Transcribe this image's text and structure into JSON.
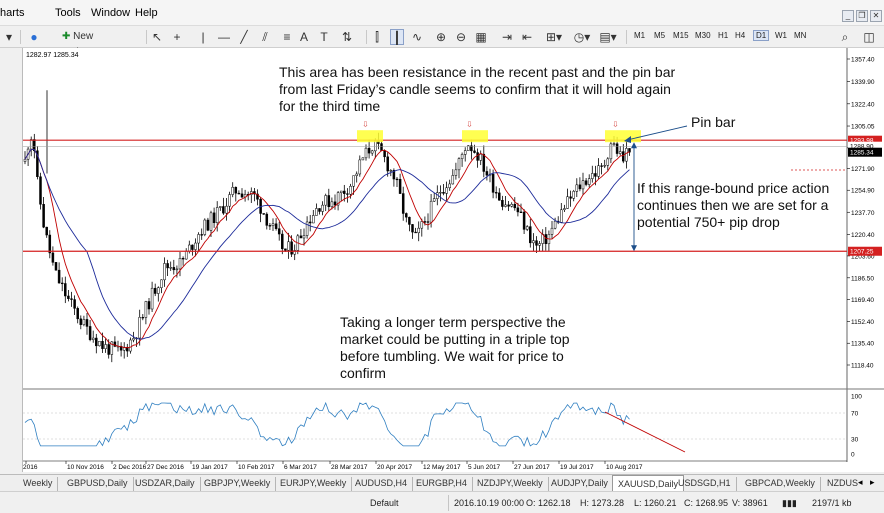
{
  "menu": {
    "items": [
      "harts",
      "Tools",
      "Window",
      "Help"
    ]
  },
  "toolbar": {
    "new_order_label": "New Order",
    "timeframes": [
      "M1",
      "M5",
      "M15",
      "M30",
      "H1",
      "H4",
      "D1",
      "W1",
      "MN"
    ],
    "active_timeframe": "D1"
  },
  "chart": {
    "ohlc_header": "1282.97 1285.34",
    "price_axis": [
      "1357.40",
      "1339.90",
      "1322.40",
      "1305.05",
      "1288.00",
      "1271.90",
      "1254.90",
      "1237.70",
      "1220.40",
      "1203.60",
      "1186.50",
      "1169.40",
      "1152.40",
      "1135.40",
      "1118.40"
    ],
    "price_label_upper": "1293.98",
    "price_label_mid": "1288.90",
    "price_label_current": "1285.34",
    "price_label_lower": "1207.25",
    "date_axis": [
      "2016",
      "10 Nov 2016",
      "2 Dec 2016",
      "27 Dec 2016",
      "19 Jan 2017",
      "10 Feb 2017",
      "6 Mar 2017",
      "28 Mar 2017",
      "20 Apr 2017",
      "12 May 2017",
      "5 Jun 2017",
      "27 Jun 2017",
      "19 Jul 2017",
      "10 Aug 2017"
    ],
    "indicator_axis": [
      "100",
      "70",
      "30",
      "0"
    ],
    "resistance_price": 1293.98,
    "support_price": 1207.25
  },
  "annotations": {
    "resistance_note": "This area has been resistance in the recent past and the pin bar from last Friday’s candle seems to confirm that it will hold again for the third time",
    "pin_bar_label": "Pin bar",
    "range_note": "If this range-bound price action continues then we are set for a potential 750+ pip drop",
    "triple_top_note": "Taking a longer term perspective the market could be putting in a triple top before tumbling. We wait for price to confirm"
  },
  "tabs": {
    "items": [
      "Weekly",
      "GBPUSD,Daily",
      "USDZAR,Daily",
      "GBPJPY,Weekly",
      "EURJPY,Weekly",
      "AUDUSD,H4",
      "EURGBP,H4",
      "NZDJPY,Weekly",
      "AUDJPY,Daily",
      "XAUUSD,Daily",
      "USDSGD,H1",
      "GBPCAD,Weekly",
      "NZDUS"
    ],
    "active": "XAUUSD,Daily"
  },
  "status": {
    "profile": "Default",
    "datetime": "2016.10.19 00:00",
    "open": "O: 1262.18",
    "high": "H: 1273.28",
    "low": "L: 1260.21",
    "close": "C: 1268.95",
    "volume": "V: 38961",
    "traffic": "2197/1 kb"
  },
  "colors": {
    "level_line": "#d42020",
    "candle": "#000000",
    "ma_fast": "#c00000",
    "ma_slow": "#1d2b9a",
    "indicator": "#2f7fc1",
    "highlight": "#ffff33",
    "arrow": "#1c4e8a"
  }
}
